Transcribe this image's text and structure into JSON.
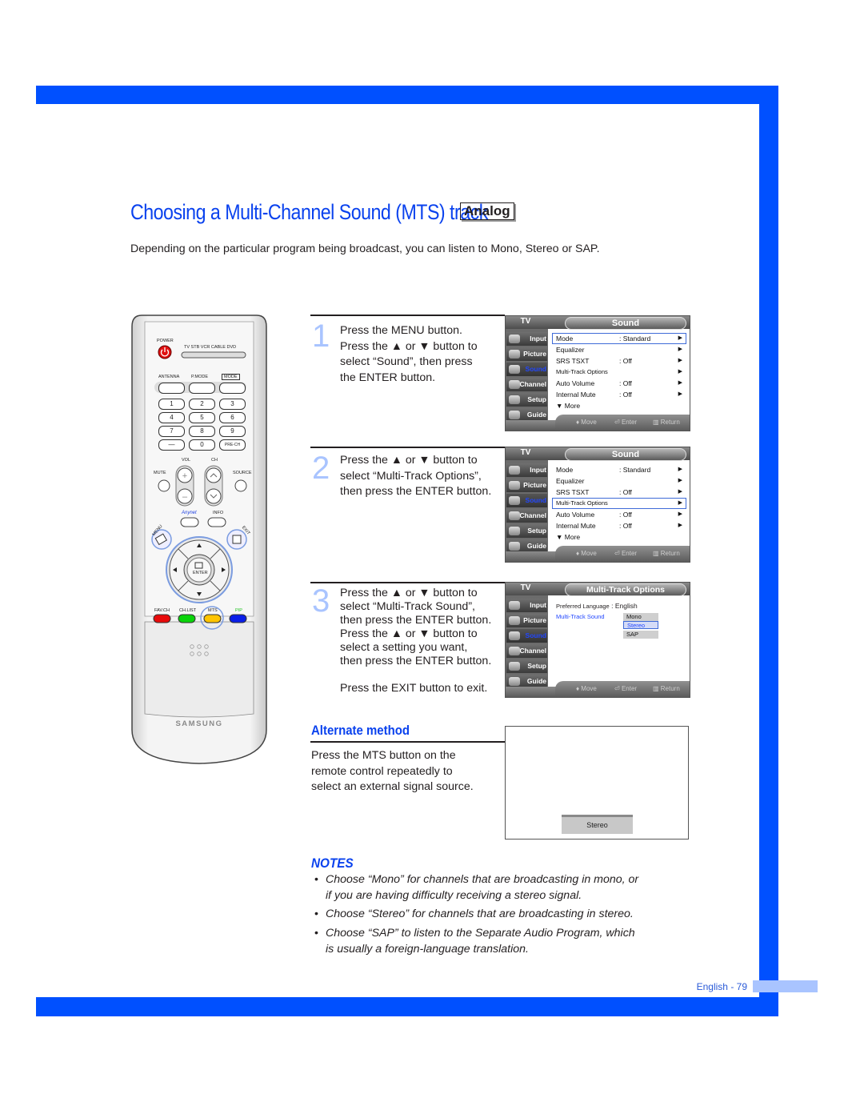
{
  "page": {
    "title": "Choosing a Multi-Channel Sound (MTS) track",
    "badge": "Analog",
    "intro": "Depending on the particular program being broadcast, you can listen to Mono, Stereo or SAP.",
    "page_number": "English - 79",
    "colors": {
      "accent": "#0050ff",
      "tab": "#a9c4ff",
      "step_number": "#a9c4ff",
      "heading": "#0a42ee"
    }
  },
  "steps": [
    {
      "number": "1",
      "lines": [
        "Press the MENU button.",
        "Press the ▲ or ▼ button to",
        "select “Sound”, then press",
        "the ENTER button."
      ]
    },
    {
      "number": "2",
      "lines": [
        "Press the ▲ or ▼ button to",
        "select “Multi-Track Options”,",
        "then press the ENTER button."
      ]
    },
    {
      "number": "3",
      "lines": [
        "Press the ▲ or ▼ button to",
        "select “Multi-Track Sound”,",
        "then press the ENTER button.",
        "Press the ▲ or ▼ button to",
        "select a setting you want,",
        "then press the ENTER button.",
        "",
        "Press the EXIT button to exit."
      ]
    }
  ],
  "osd": {
    "tv_label": "TV",
    "sidebar": [
      "Input",
      "Picture",
      "Sound",
      "Channel",
      "Setup",
      "Guide"
    ],
    "hints": {
      "move": "♦ Move",
      "enter": "Enter",
      "return": "Return"
    },
    "sound_menu": {
      "title": "Sound",
      "rows": [
        {
          "label": "Mode",
          "value": ": Standard",
          "arrow": "▶"
        },
        {
          "label": "Equalizer",
          "value": "",
          "arrow": "▶"
        },
        {
          "label": "SRS TSXT",
          "value": ": Off",
          "arrow": "▶"
        },
        {
          "label": "Multi-Track Options",
          "value": "",
          "arrow": "▶"
        },
        {
          "label": "Auto Volume",
          "value": ": Off",
          "arrow": "▶"
        },
        {
          "label": "Internal Mute",
          "value": ": Off",
          "arrow": "▶"
        },
        {
          "label": "▼ More",
          "value": "",
          "arrow": ""
        }
      ]
    },
    "mts_menu": {
      "title": "Multi-Track Options",
      "preferred_language_label": "Preferred Language",
      "preferred_language_value": ": English",
      "multi_track_label": "Multi-Track Sound",
      "options": [
        "Mono",
        "Stereo",
        "SAP"
      ],
      "selected": "Stereo"
    }
  },
  "alternate": {
    "title": "Alternate method",
    "lines": [
      "Press the MTS button on the",
      "remote control repeatedly to",
      "select an external signal source."
    ],
    "screen_label": "Stereo"
  },
  "notes": {
    "title": "NOTES",
    "items": [
      [
        "Choose “Mono” for channels that are broadcasting in mono, or",
        "if you are having difficulty receiving a stereo signal."
      ],
      [
        "Choose “Stereo” for channels that are broadcasting in stereo."
      ],
      [
        "Choose “SAP” to listen to the Separate Audio Program, which",
        "is usually a foreign-language translation."
      ]
    ]
  },
  "remote": {
    "power": "POWER",
    "modes": "TV  STB  VCR  CABLE  DVD",
    "antenna": "ANTENNA",
    "pmode": "P.MODE",
    "mode": "MODE",
    "digits": [
      "1",
      "2",
      "3",
      "4",
      "5",
      "6",
      "7",
      "8",
      "9",
      "—",
      "0",
      "PRE-CH"
    ],
    "vol": "VOL",
    "ch": "CH",
    "mute": "MUTE",
    "source": "SOURCE",
    "anynet": "Anynet",
    "info": "INFO",
    "menu": "MENU",
    "exit": "EXIT",
    "enter": "ENTER",
    "fav_ch": "FAV.CH",
    "ch_list": "CH.LIST",
    "mts": "MTS",
    "pip": "PIP",
    "brand": "SAMSUNG"
  }
}
